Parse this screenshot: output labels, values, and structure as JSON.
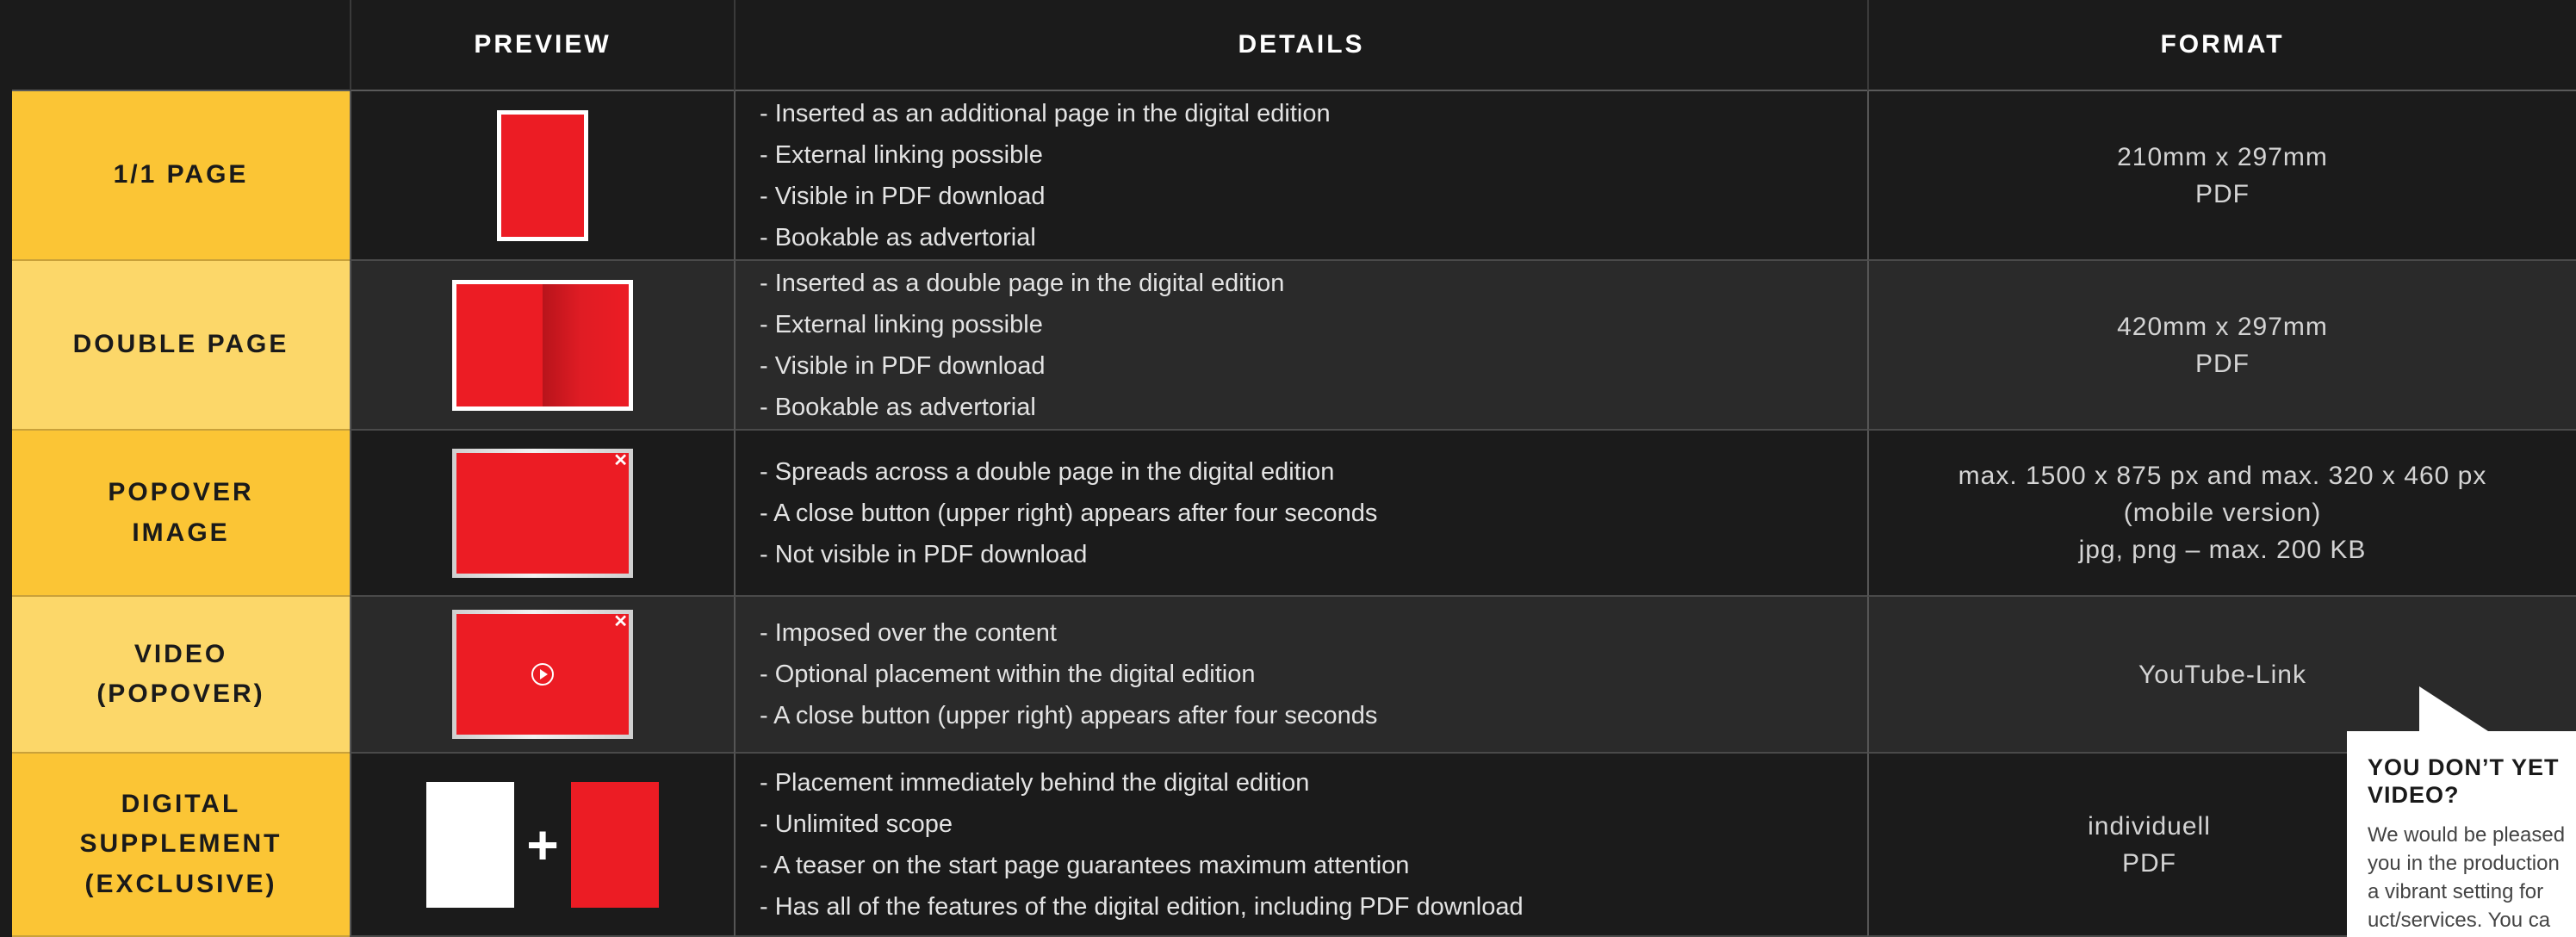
{
  "headers": [
    "",
    "PREVIEW",
    "DETAILS",
    "FORMAT"
  ],
  "rows": [
    {
      "type_lines": [
        "1/1 PAGE"
      ],
      "preview_icon": "single-page-icon",
      "details": [
        "- Inserted as an additional page in the digital edition",
        "- External linking possible",
        "- Visible in PDF download",
        "- Bookable as advertorial"
      ],
      "format": [
        "210mm x 297mm",
        "PDF"
      ]
    },
    {
      "type_lines": [
        "DOUBLE PAGE"
      ],
      "preview_icon": "double-page-icon",
      "details": [
        "- Inserted as a double page in the digital edition",
        "- External linking possible",
        "- Visible in PDF download",
        "- Bookable as advertorial"
      ],
      "format": [
        "420mm x 297mm",
        "PDF"
      ]
    },
    {
      "type_lines": [
        "POPOVER",
        "IMAGE"
      ],
      "preview_icon": "popover-image-icon",
      "details": [
        "- Spreads across a double page in the digital edition",
        "- A close button (upper right) appears after four seconds",
        "- Not visible in PDF download"
      ],
      "format": [
        "max. 1500 x 875 px and max. 320 x 460 px",
        "(mobile version)",
        "jpg, png – max. 200 KB"
      ]
    },
    {
      "type_lines": [
        "VIDEO",
        "(POPOVER)"
      ],
      "preview_icon": "video-popover-icon",
      "details": [
        "- Imposed over the content",
        "- Optional placement within the digital edition",
        "- A close button (upper right) appears after four seconds"
      ],
      "format": [
        "YouTube-Link"
      ]
    },
    {
      "type_lines": [
        "DIGITAL",
        "SUPPLEMENT",
        "(EXCLUSIVE)"
      ],
      "preview_icon": "supplement-icon",
      "details": [
        "- Placement immediately behind the digital edition",
        "- Unlimited scope",
        "- A teaser on the start page guarantees maximum attention",
        "- Has all of the features of the digital edition, including PDF download"
      ],
      "format": [
        "individuell",
        "PDF"
      ]
    }
  ],
  "close_glyph": "✕",
  "plus_glyph": "+",
  "callout": {
    "title_lines": [
      "YOU DON’T YET",
      "VIDEO?"
    ],
    "text_lines": [
      "We would be pleased",
      "you in the production",
      "a vibrant setting for",
      "uct/services. You ca"
    ]
  },
  "colors": {
    "background": "#1b1b1b",
    "row_alt": "#2a2a2a",
    "type_yellow": "#fbc535",
    "type_yellow_light": "#fcd769",
    "accent_red": "#ec1c24"
  }
}
